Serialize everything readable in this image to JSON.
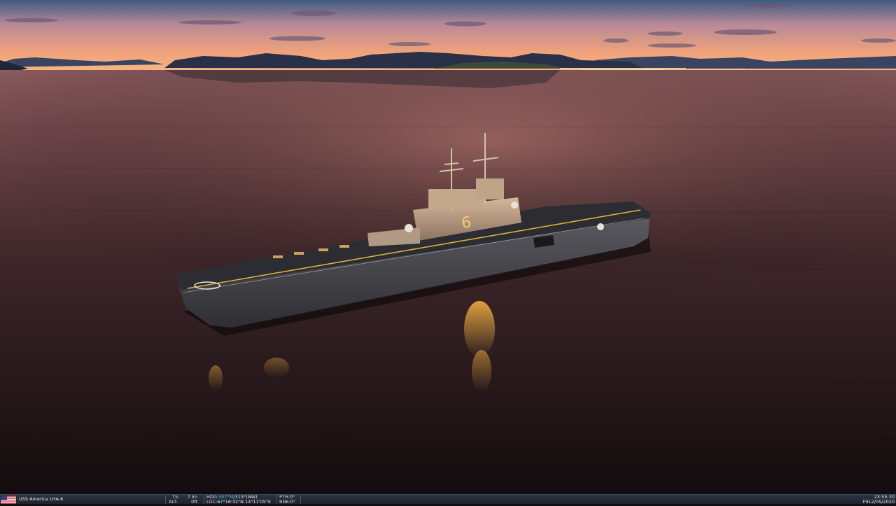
{
  "scene": {
    "name": "USS America LHA-6 at dusk",
    "hull_number": "6",
    "colors": {
      "sky_top": "#3e5a7e",
      "sky_horizon": "#f2a477",
      "water": "#241619",
      "hull": "#4a4a50",
      "deck_line": "#d8b23a"
    }
  },
  "status_bar": {
    "flag_icon": "us-flag-icon",
    "unit_name": "USS America LHA-6",
    "ts_label": "TS:",
    "ts_value": "7 kn",
    "alt_label": "ALT:",
    "alt_value": "0ft",
    "hdg_label": "HDG:",
    "hdg_magnetic": "307°M",
    "hdg_true": "/313°(NW)",
    "loc_label": "LOC:",
    "loc_value": "67°16'32\"N 14°11'05\"E",
    "pth_label": "PTH:",
    "pth_value": "0°",
    "bnk_label": "BNK:",
    "bnk_value": "0°",
    "time": "23:55:30",
    "date": "F912/05/2020"
  }
}
